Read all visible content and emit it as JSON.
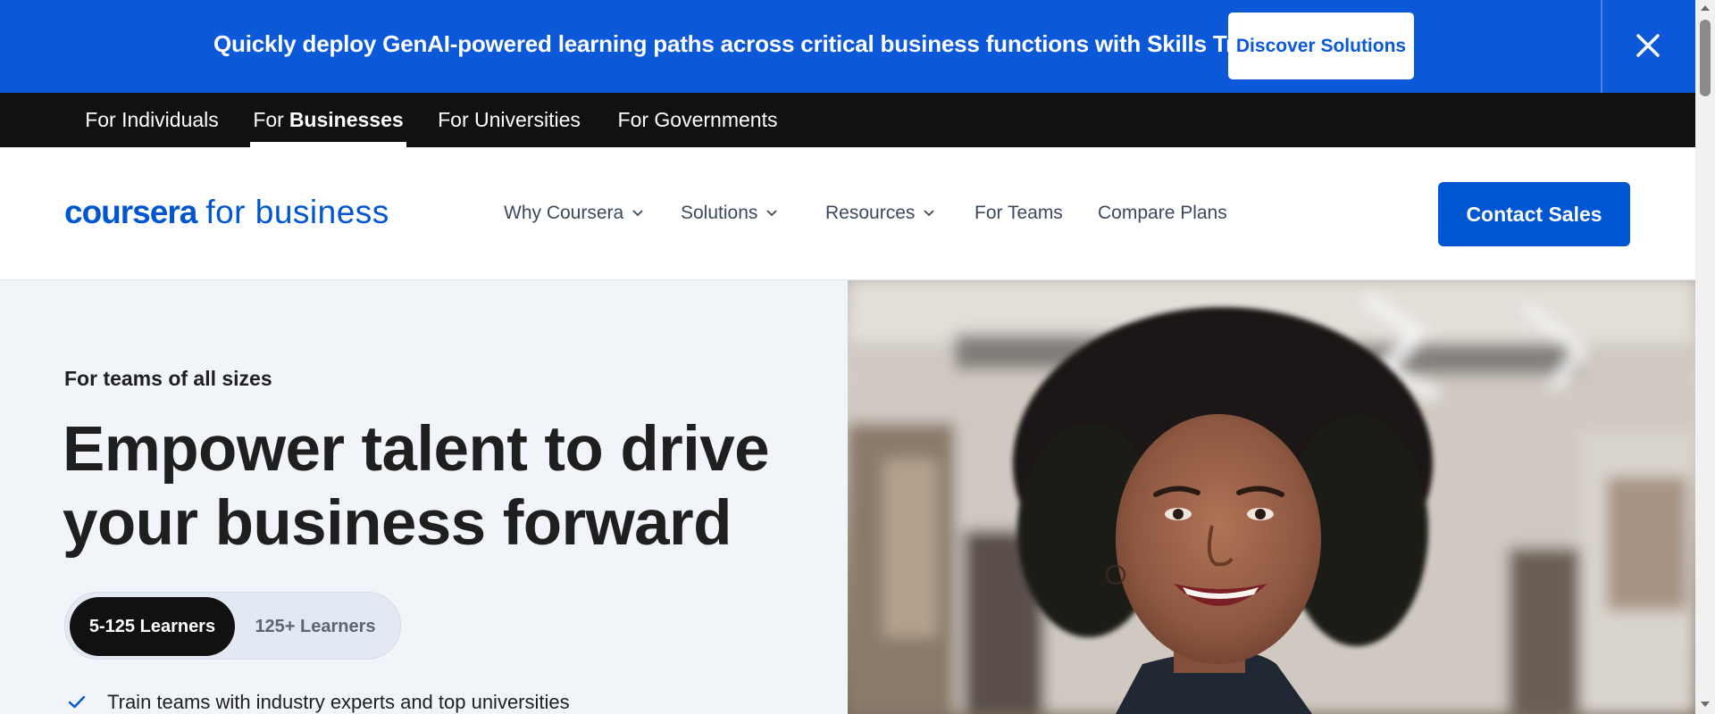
{
  "banner": {
    "message": "Quickly deploy GenAI-powered learning paths across critical business functions with Skills Tracks",
    "cta_label": "Discover Solutions",
    "close_icon": "close-icon"
  },
  "audience_nav": {
    "individuals": "For Individuals",
    "businesses_prefix": "For",
    "businesses_strong": "Businesses",
    "universities": "For Universities",
    "governments": "For Governments",
    "active": "For Businesses"
  },
  "header": {
    "logo_brand": "coursera",
    "logo_suffix": "for business",
    "nav": {
      "why": "Why Coursera",
      "solutions": "Solutions",
      "resources": "Resources",
      "teams": "For Teams",
      "compare": "Compare Plans"
    },
    "contact_label": "Contact Sales"
  },
  "hero": {
    "eyebrow": "For teams of all sizes",
    "headline_line1": "Empower talent to drive",
    "headline_line2": "your business forward",
    "toggle_small": "5-125 Learners",
    "toggle_large": "125+ Learners",
    "toggle_selected": "5-125 Learners",
    "bullet_1": "Train teams with industry experts and top universities"
  },
  "colors": {
    "banner_bg": "#0b58d9",
    "brand_blue": "#0056d2",
    "audience_bg": "#111111",
    "hero_bg": "#f1f4f9"
  }
}
